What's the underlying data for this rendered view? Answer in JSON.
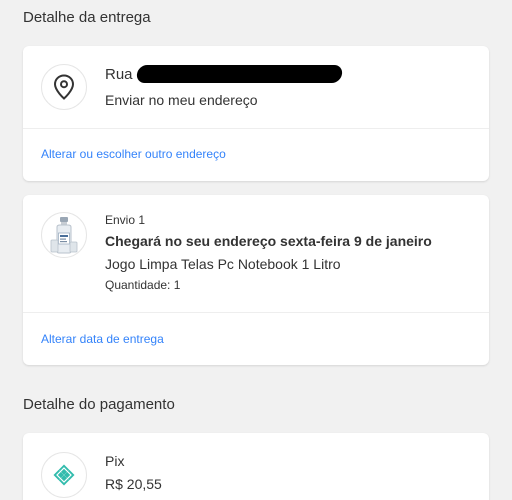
{
  "delivery": {
    "section_title": "Detalhe da entrega",
    "address": {
      "street_prefix": "Rua",
      "subtitle": "Enviar no meu endereço",
      "change_link": "Alterar ou escolher outro endereço",
      "icon": "location-pin-icon"
    },
    "shipment": {
      "label": "Envio 1",
      "arrival": "Chegará no seu endereço sexta-feira 9 de janeiro",
      "product": "Jogo Limpa Telas Pc Notebook 1 Litro",
      "quantity": "Quantidade: 1",
      "change_link": "Alterar data de entrega",
      "icon": "product-thumbnail"
    }
  },
  "payment": {
    "section_title": "Detalhe do pagamento",
    "method": "Pix",
    "amount": "R$ 20,55",
    "icon": "pix-icon",
    "icon_color": "#32bcad"
  },
  "colors": {
    "link": "#3483fa",
    "background": "#f1f1f1",
    "card": "#ffffff"
  }
}
